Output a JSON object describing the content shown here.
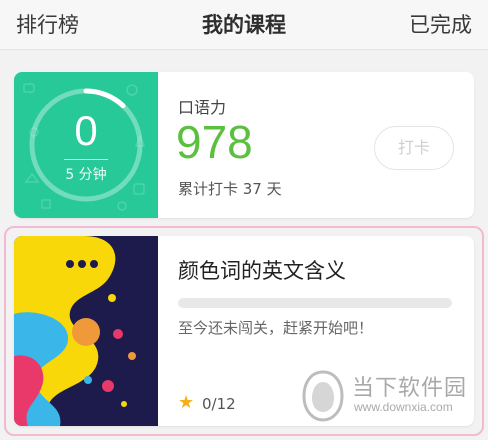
{
  "nav": {
    "left_label": "排行榜",
    "title": "我的课程",
    "right_label": "已完成"
  },
  "speaking_card": {
    "ring_value": "0",
    "ring_sub": "5 分钟",
    "ring_progress": 0.12,
    "name": "口语力",
    "score": "978",
    "streak_text": "累计打卡 37 天",
    "checkin_label": "打卡"
  },
  "course_card": {
    "title": "颜色词的英文含义",
    "progress": 0,
    "hint": "至今还未闯关，赶紧开始吧！",
    "star_icon": "star-icon",
    "count": "0/12"
  },
  "watermark": {
    "name": "当下软件园",
    "url": "www.downxia.com"
  },
  "colors": {
    "accent_green": "#27c999",
    "score_green": "#5bbf3f",
    "highlight_pink": "#f2b9d2",
    "star": "#f5b01b"
  }
}
